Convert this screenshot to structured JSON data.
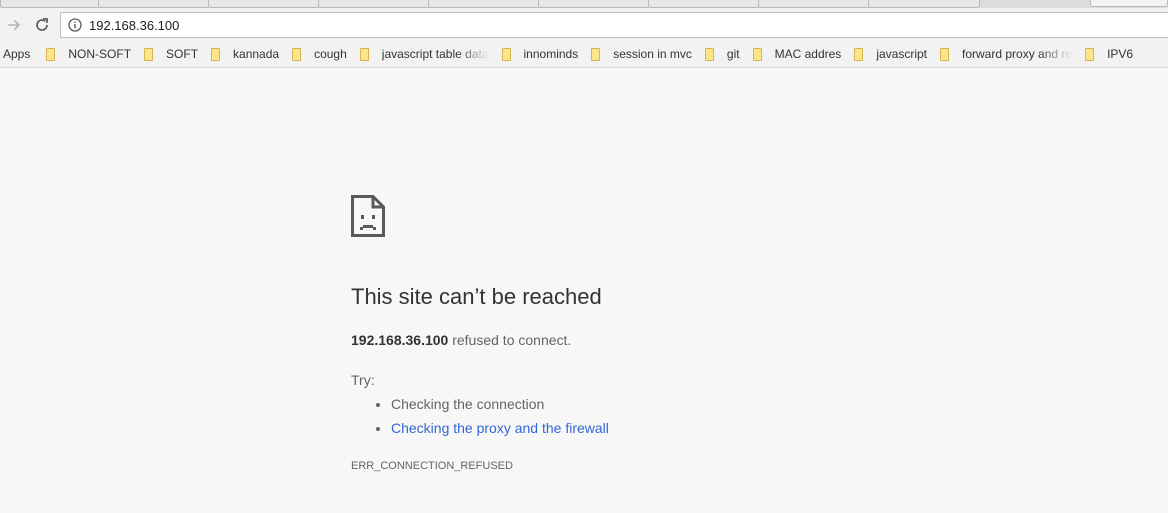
{
  "browser": {
    "address": "192.168.36.100",
    "apps_label": "Apps",
    "bookmarks": [
      {
        "label": "NON-SOFT"
      },
      {
        "label": "SOFT"
      },
      {
        "label": "kannada"
      },
      {
        "label": "cough"
      },
      {
        "label": "javascript table data"
      },
      {
        "label": "innominds"
      },
      {
        "label": "session in mvc"
      },
      {
        "label": "git"
      },
      {
        "label": "MAC addres"
      },
      {
        "label": "javascript"
      },
      {
        "label": "forward proxy and re"
      },
      {
        "label": "IPV6"
      }
    ]
  },
  "error": {
    "icon": "sad-page-icon",
    "title": "This site can’t be reached",
    "host": "192.168.36.100",
    "message": " refused to connect.",
    "try_label": "Try:",
    "suggestions": [
      {
        "text": "Checking the connection",
        "link": false
      },
      {
        "text": "Checking the proxy and the firewall",
        "link": true
      }
    ],
    "code": "ERR_CONNECTION_REFUSED"
  },
  "colors": {
    "page_background": "#f7f7f7",
    "title_text": "#333333",
    "body_text": "#646464",
    "link": "#3367d6",
    "folder": "#fde58a"
  }
}
